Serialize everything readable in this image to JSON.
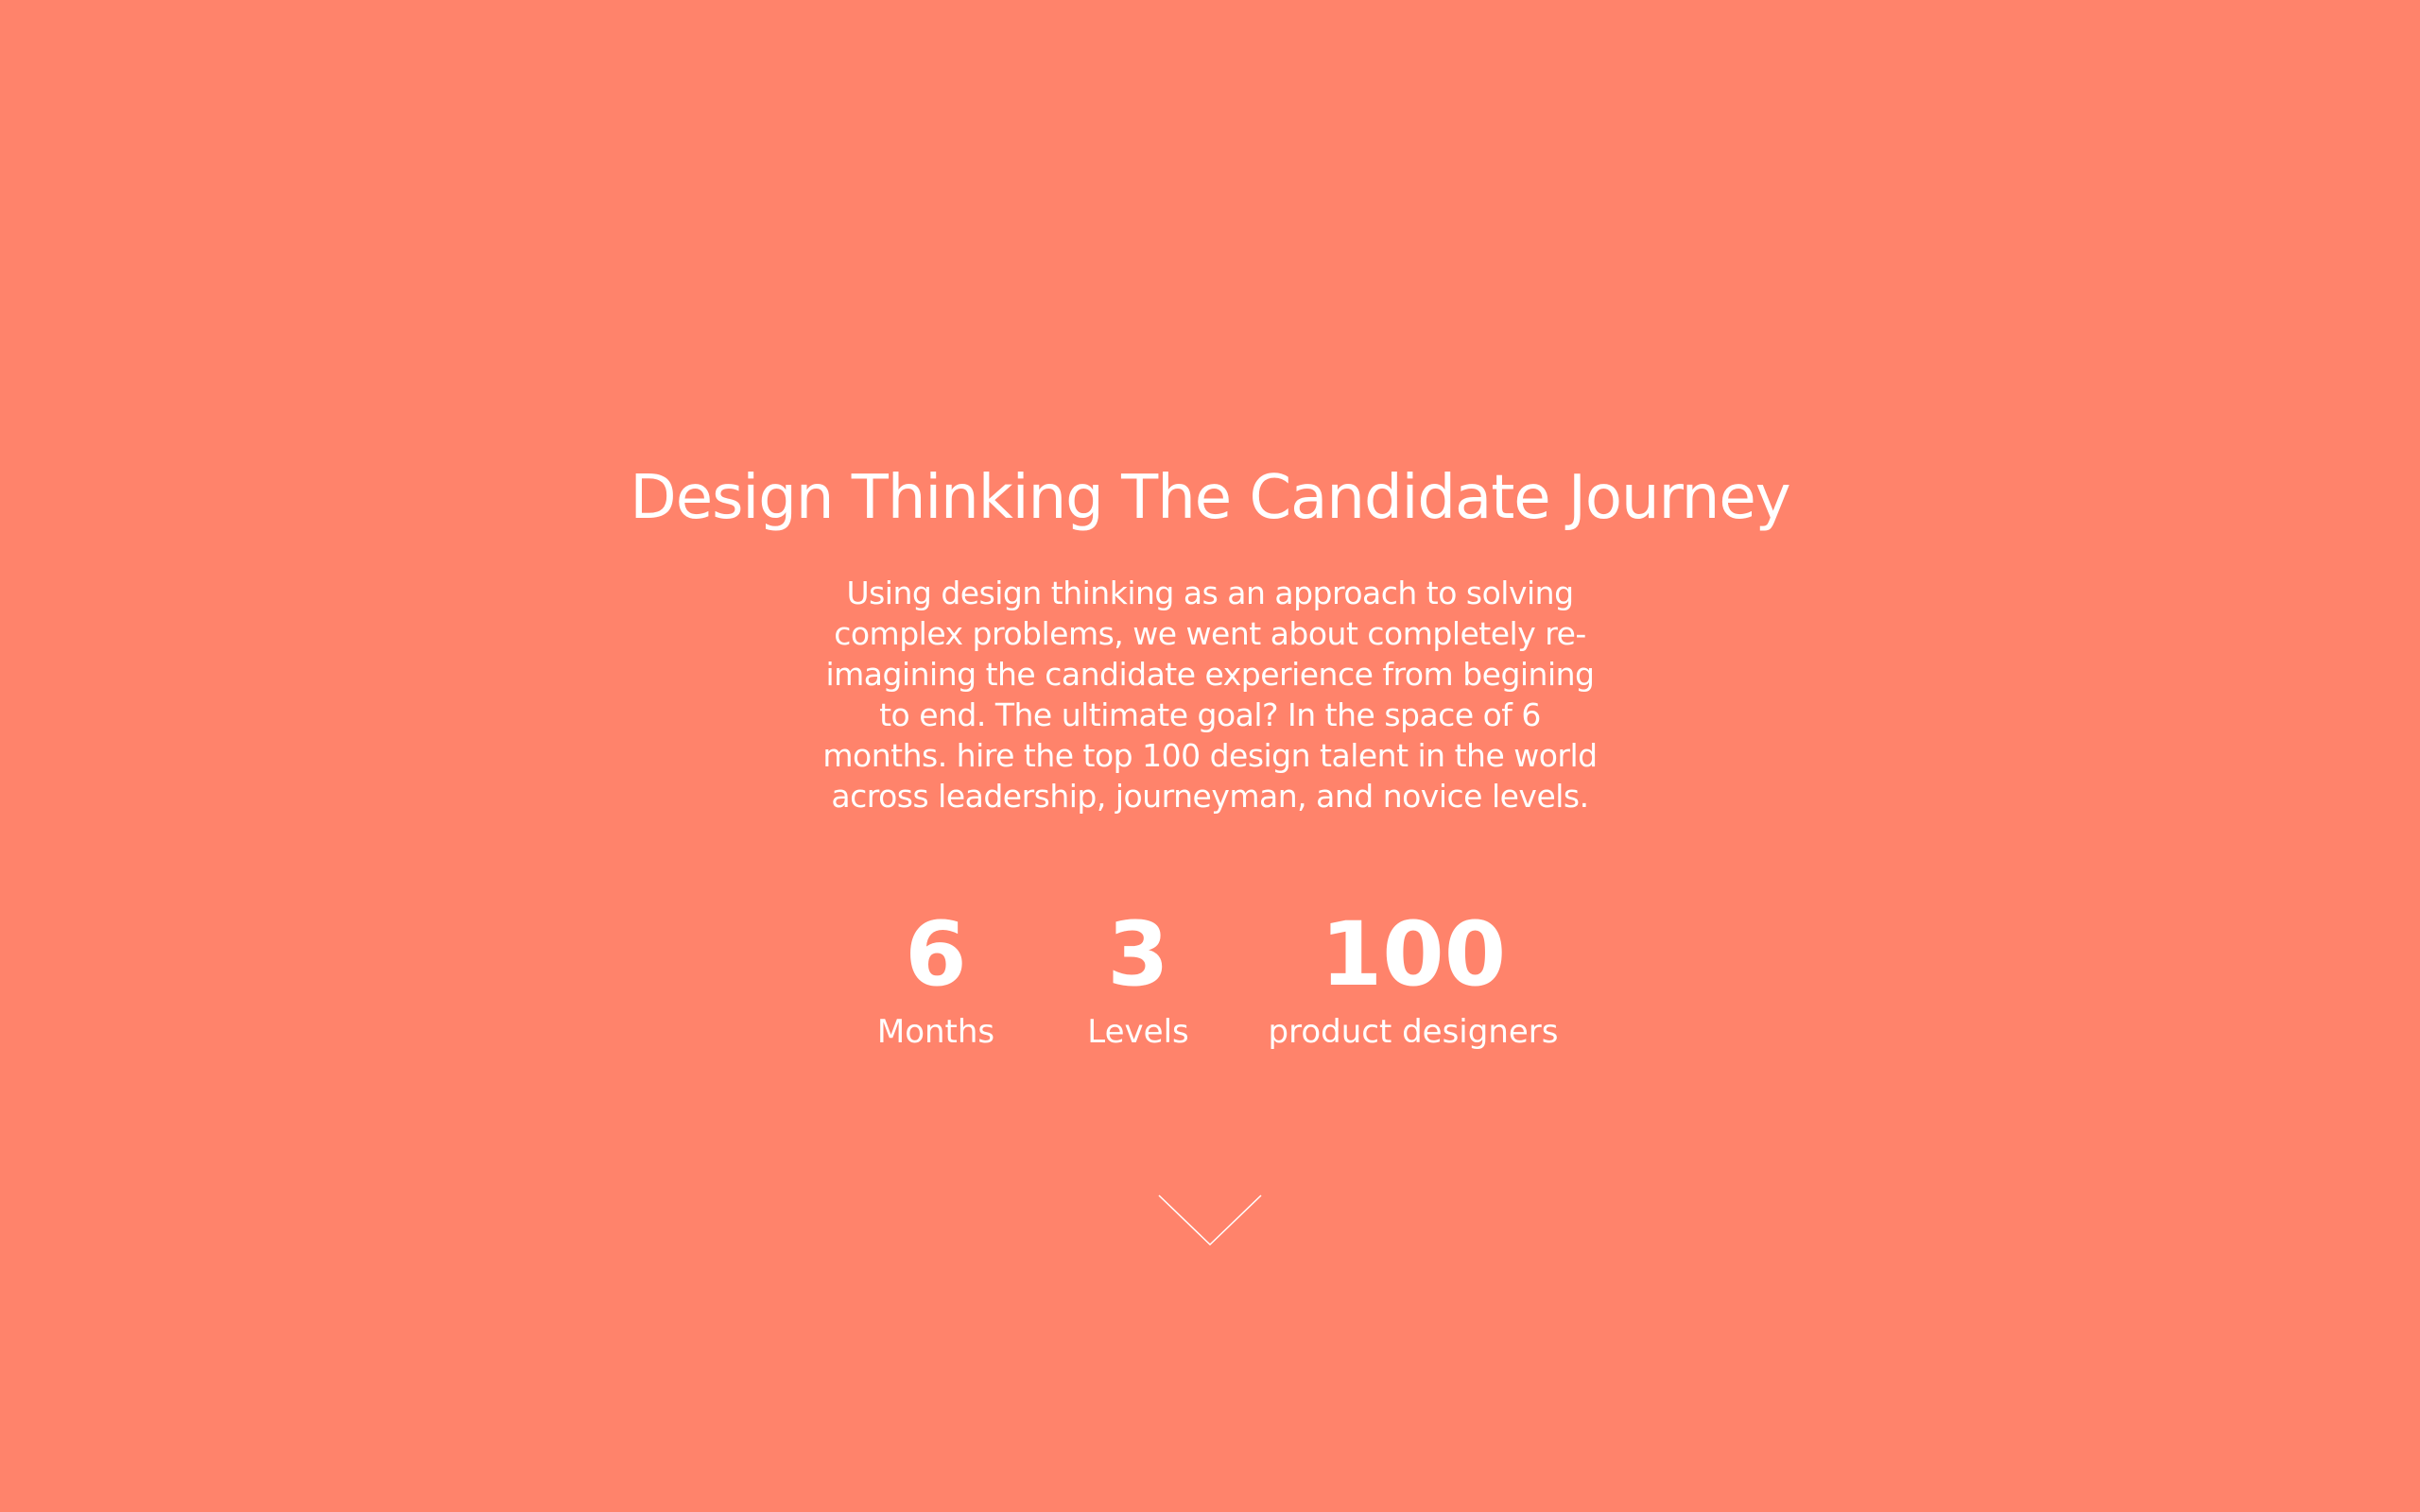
{
  "hero": {
    "title": "Design Thinking The Candidate Journey",
    "description": "Using design thinking as an approach to solving complex problems, we went about completely re-imagining the candidate experience from begining to end. The ultimate goal? In the space of 6 months. hire the top 100 design talent in the world across leadership, journeyman, and novice levels."
  },
  "stats": {
    "months": {
      "value": "6",
      "label": "Months"
    },
    "levels": {
      "value": "3",
      "label": "Levels"
    },
    "designers": {
      "value": "100",
      "label": "product designers"
    }
  },
  "scroll": {
    "icon": "chevron-down-icon"
  },
  "colors": {
    "background": "#FF836B",
    "text": "#FFFFFF"
  }
}
